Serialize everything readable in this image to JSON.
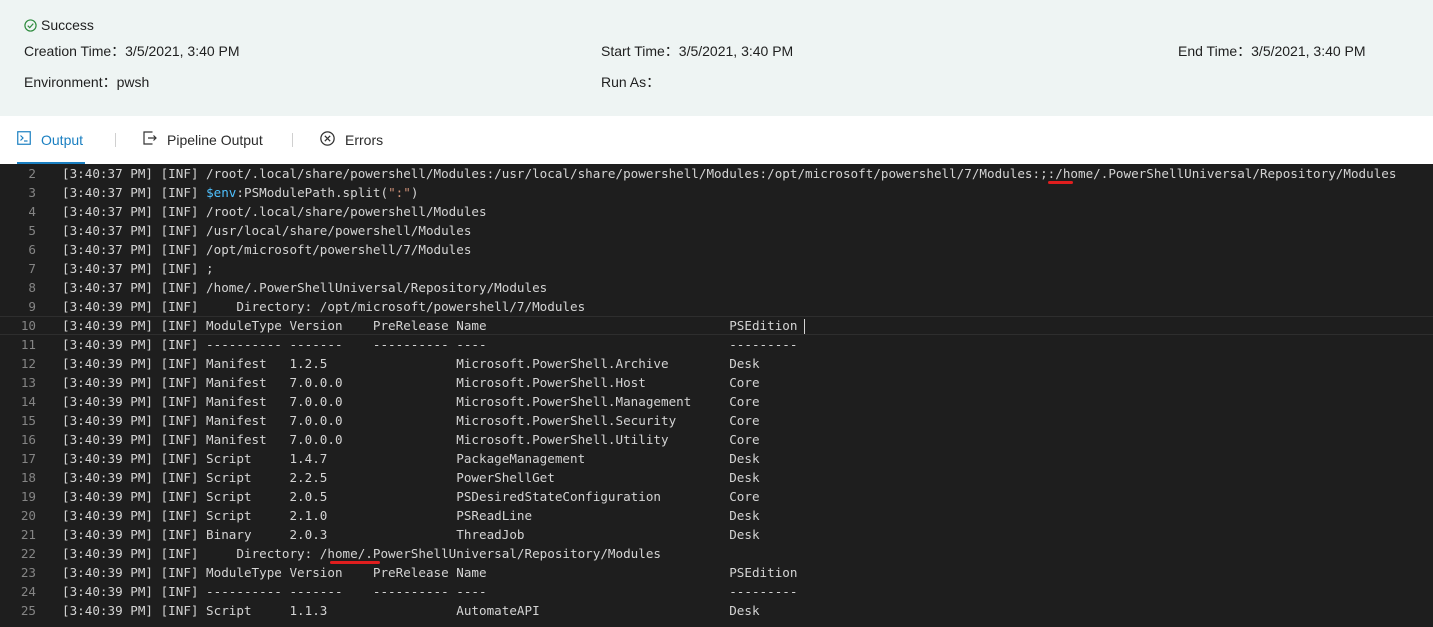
{
  "job": {
    "status": "Success",
    "creation_time": "Creation Time：3/5/2021, 3:40 PM",
    "start_time": "Start Time：3/5/2021, 3:40 PM",
    "end_time": "End Time：3/5/2021, 3:40 PM",
    "environment": "Environment：pwsh",
    "run_as": "Run As："
  },
  "tabs": [
    {
      "label": "Output",
      "icon": "terminal-icon",
      "active": true
    },
    {
      "label": "Pipeline Output",
      "icon": "pipeline-output-icon",
      "active": false
    },
    {
      "label": "Errors",
      "icon": "error-circle-icon",
      "active": false
    }
  ],
  "colors": {
    "accent": "#1a7fc1",
    "success": "#2e8b3e",
    "console_bg": "#1e1e1e",
    "annotation_red": "#e01e1e"
  },
  "console": {
    "lines": [
      {
        "n": "2",
        "text": "[3:40:37 PM] [INF] /root/.local/share/powershell/Modules:/usr/local/share/powershell/Modules:/opt/microsoft/powershell/7/Modules:;:/home/.PowerShellUniversal/Repository/Modules"
      },
      {
        "n": "3",
        "ts": "[3:40:37 PM] [INF] ",
        "var": "$env",
        "mid": ":PSModulePath.split(",
        "str": "\":\"",
        "end": ")"
      },
      {
        "n": "4",
        "text": "[3:40:37 PM] [INF] /root/.local/share/powershell/Modules"
      },
      {
        "n": "5",
        "text": "[3:40:37 PM] [INF] /usr/local/share/powershell/Modules"
      },
      {
        "n": "6",
        "text": "[3:40:37 PM] [INF] /opt/microsoft/powershell/7/Modules"
      },
      {
        "n": "7",
        "text": "[3:40:37 PM] [INF] ;"
      },
      {
        "n": "8",
        "text": "[3:40:37 PM] [INF] /home/.PowerShellUniversal/Repository/Modules"
      },
      {
        "n": "9",
        "text": "[3:40:39 PM] [INF]     Directory: /opt/microsoft/powershell/7/Modules"
      },
      {
        "n": "10",
        "text": "[3:40:39 PM] [INF] ModuleType Version    PreRelease Name                                PSEdition",
        "current": true
      },
      {
        "n": "11",
        "text": "[3:40:39 PM] [INF] ---------- -------    ---------- ----                                ---------"
      },
      {
        "n": "12",
        "text": "[3:40:39 PM] [INF] Manifest   1.2.5                 Microsoft.PowerShell.Archive        Desk"
      },
      {
        "n": "13",
        "text": "[3:40:39 PM] [INF] Manifest   7.0.0.0               Microsoft.PowerShell.Host           Core"
      },
      {
        "n": "14",
        "text": "[3:40:39 PM] [INF] Manifest   7.0.0.0               Microsoft.PowerShell.Management     Core"
      },
      {
        "n": "15",
        "text": "[3:40:39 PM] [INF] Manifest   7.0.0.0               Microsoft.PowerShell.Security       Core"
      },
      {
        "n": "16",
        "text": "[3:40:39 PM] [INF] Manifest   7.0.0.0               Microsoft.PowerShell.Utility        Core"
      },
      {
        "n": "17",
        "text": "[3:40:39 PM] [INF] Script     1.4.7                 PackageManagement                   Desk"
      },
      {
        "n": "18",
        "text": "[3:40:39 PM] [INF] Script     2.2.5                 PowerShellGet                       Desk"
      },
      {
        "n": "19",
        "text": "[3:40:39 PM] [INF] Script     2.0.5                 PSDesiredStateConfiguration         Core"
      },
      {
        "n": "20",
        "text": "[3:40:39 PM] [INF] Script     2.1.0                 PSReadLine                          Desk"
      },
      {
        "n": "21",
        "text": "[3:40:39 PM] [INF] Binary     2.0.3                 ThreadJob                           Desk"
      },
      {
        "n": "22",
        "text": "[3:40:39 PM] [INF]     Directory: /home/.PowerShellUniversal/Repository/Modules"
      },
      {
        "n": "23",
        "text": "[3:40:39 PM] [INF] ModuleType Version    PreRelease Name                                PSEdition"
      },
      {
        "n": "24",
        "text": "[3:40:39 PM] [INF] ---------- -------    ---------- ----                                ---------"
      },
      {
        "n": "25",
        "text": "[3:40:39 PM] [INF] Script     1.1.3                 AutomateAPI                         Desk"
      }
    ]
  }
}
